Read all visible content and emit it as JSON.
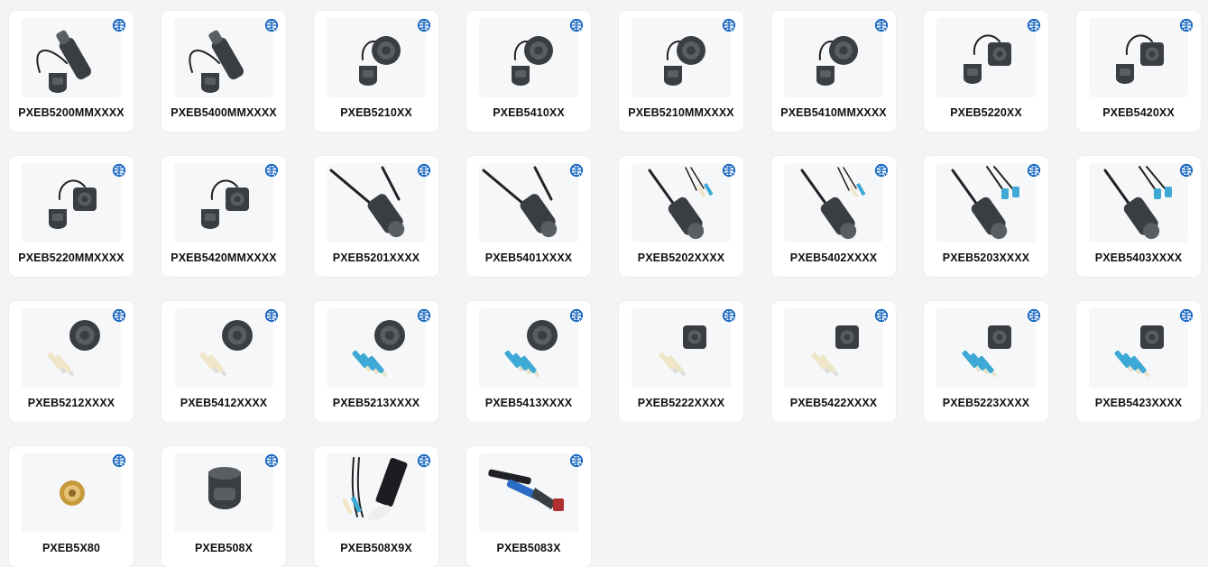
{
  "products": [
    {
      "label": "PXEB5200MMXXXX",
      "icon": "connector-with-cable-and-cap"
    },
    {
      "label": "PXEB5400MMXXXX",
      "icon": "connector-with-cable-and-cap"
    },
    {
      "label": "PXEB5210XX",
      "icon": "receptacle-with-cap"
    },
    {
      "label": "PXEB5410XX",
      "icon": "receptacle-with-cap"
    },
    {
      "label": "PXEB5210MMXXXX",
      "icon": "receptacle-with-cap"
    },
    {
      "label": "PXEB5410MMXXXX",
      "icon": "receptacle-with-cap"
    },
    {
      "label": "PXEB5220XX",
      "icon": "flange-receptacle-with-cap"
    },
    {
      "label": "PXEB5420XX",
      "icon": "flange-receptacle-with-cap"
    },
    {
      "label": "PXEB5220MMXXXX",
      "icon": "flange-receptacle-with-cap"
    },
    {
      "label": "PXEB5420MMXXXX",
      "icon": "flange-receptacle-with-cap"
    },
    {
      "label": "PXEB5201XXXX",
      "icon": "plug-assembly-with-cable"
    },
    {
      "label": "PXEB5401XXXX",
      "icon": "plug-assembly-with-cable"
    },
    {
      "label": "PXEB5202XXXX",
      "icon": "plug-assembly-with-fiber-pigtails"
    },
    {
      "label": "PXEB5402XXXX",
      "icon": "plug-assembly-with-fiber-pigtails"
    },
    {
      "label": "PXEB5203XXXX",
      "icon": "plug-assembly-with-lc-connectors"
    },
    {
      "label": "PXEB5403XXXX",
      "icon": "plug-assembly-with-lc-connectors"
    },
    {
      "label": "PXEB5212XXXX",
      "icon": "receptacle-with-ferrules"
    },
    {
      "label": "PXEB5412XXXX",
      "icon": "receptacle-with-ferrules"
    },
    {
      "label": "PXEB5213XXXX",
      "icon": "receptacle-with-lc-connectors"
    },
    {
      "label": "PXEB5413XXXX",
      "icon": "receptacle-with-lc-connectors"
    },
    {
      "label": "PXEB5222XXXX",
      "icon": "flange-receptacle-with-ferrules"
    },
    {
      "label": "PXEB5422XXXX",
      "icon": "flange-receptacle-with-ferrules"
    },
    {
      "label": "PXEB5223XXXX",
      "icon": "flange-receptacle-with-lc-connectors"
    },
    {
      "label": "PXEB5423XXXX",
      "icon": "flange-receptacle-with-lc-connectors"
    },
    {
      "label": "PXEB5X80",
      "icon": "brass-adapter"
    },
    {
      "label": "PXEB508X",
      "icon": "dust-cap"
    },
    {
      "label": "PXEB508X9X",
      "icon": "fiber-kit"
    },
    {
      "label": "PXEB5083X",
      "icon": "crimp-tool"
    }
  ],
  "badge_icon": "globe-cursor-icon",
  "colors": {
    "badge": "#1565c0",
    "text": "#111111",
    "card": "#ffffff",
    "page": "#f3f4f6"
  }
}
